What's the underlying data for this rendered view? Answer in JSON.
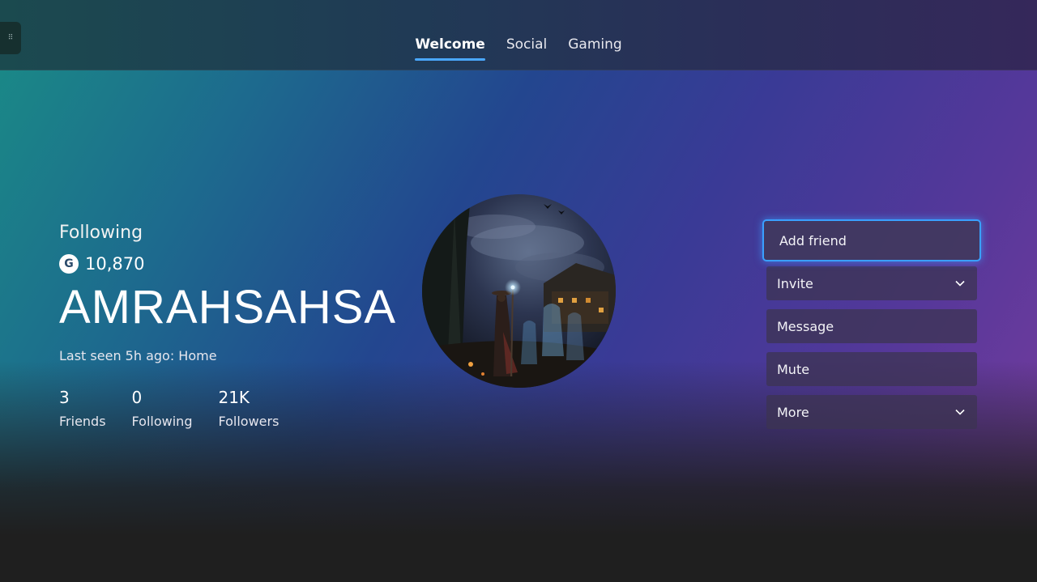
{
  "nav": {
    "tabs": [
      {
        "label": "Welcome",
        "active": true
      },
      {
        "label": "Social",
        "active": false
      },
      {
        "label": "Gaming",
        "active": false
      }
    ]
  },
  "profile": {
    "relationship": "Following",
    "gamerscore": "10,870",
    "gamerscore_icon": "G",
    "gamertag": "AMRAHSAHSA",
    "last_seen": "Last seen 5h ago: Home",
    "stats": [
      {
        "value": "3",
        "label": "Friends"
      },
      {
        "value": "0",
        "label": "Following"
      },
      {
        "value": "21K",
        "label": "Followers"
      }
    ]
  },
  "actions": {
    "add_friend": "Add friend",
    "invite": "Invite",
    "message": "Message",
    "mute": "Mute",
    "more": "More"
  },
  "colors": {
    "accent": "#4aa8ff",
    "focus_ring": "#3aa0ff",
    "bottom_bg": "#1f1f1f"
  },
  "icons": {
    "grip": "grip-dots-icon",
    "gamerscore": "gamerscore-icon",
    "chevron": "chevron-down-icon"
  }
}
